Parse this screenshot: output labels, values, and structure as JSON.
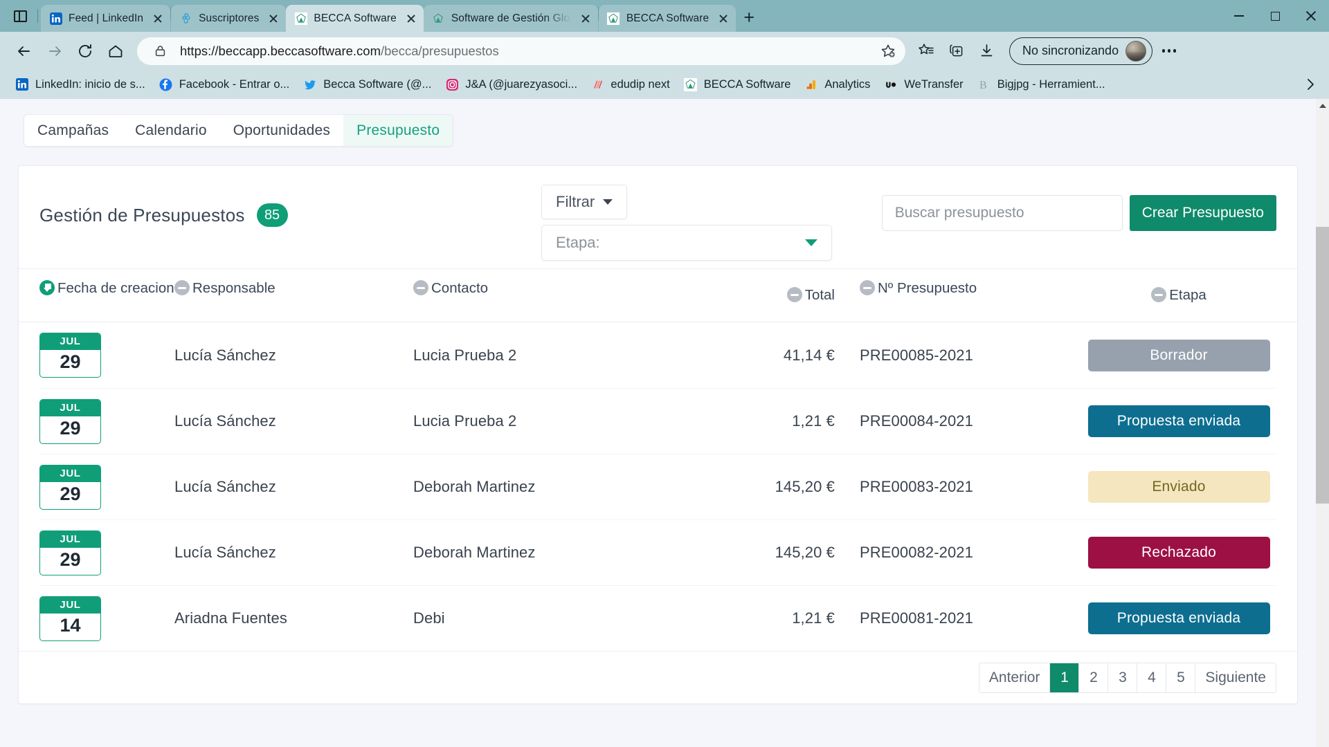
{
  "browser": {
    "tabs": [
      {
        "title": "Feed | LinkedIn",
        "icon": "linkedin-favicon",
        "active": false
      },
      {
        "title": "Suscriptores",
        "icon": "mailchimp-favicon",
        "active": false
      },
      {
        "title": "BECCA Software",
        "icon": "becca-favicon",
        "active": true
      },
      {
        "title": "Software de Gestión Glob",
        "icon": "becca-favicon",
        "active": false
      },
      {
        "title": "BECCA Software",
        "icon": "becca-favicon",
        "active": false
      }
    ],
    "newtab_label": "+",
    "window_controls": {
      "minimize": "minimize-button",
      "maximize": "maximize-button",
      "close": "close-button"
    },
    "nav": {
      "back": "back-arrow-icon",
      "forward": "forward-arrow-icon",
      "reload": "reload-icon",
      "home": "home-icon"
    },
    "address": {
      "lock": "lock-icon",
      "url_strong": "https://beccapp.beccasoftware.com",
      "url_dim": "/becca/presupuestos",
      "favorite": "add-favorite-star-icon"
    },
    "toolbar": {
      "collections": "favorites-list-icon",
      "split": "collections-icon",
      "downloads": "downloads-icon",
      "sync_label": "No sincronizando",
      "avatar": "profile-avatar",
      "settings": "more-options-icon"
    },
    "bookmarks": [
      {
        "label": "LinkedIn: inicio de s...",
        "icon": "linkedin-icon"
      },
      {
        "label": "Facebook - Entrar o...",
        "icon": "facebook-icon"
      },
      {
        "label": "Becca Software (@...",
        "icon": "twitter-icon"
      },
      {
        "label": "J&A (@juarezyasoci...",
        "icon": "instagram-icon"
      },
      {
        "label": "edudip next",
        "icon": "edudip-icon"
      },
      {
        "label": "BECCA Software",
        "icon": "becca-icon"
      },
      {
        "label": "Analytics",
        "icon": "analytics-icon"
      },
      {
        "label": "WeTransfer",
        "icon": "wetransfer-icon"
      },
      {
        "label": "Bigjpg - Herramient...",
        "icon": "bigjpg-icon"
      }
    ],
    "bookmarks_overflow": "chevron-right-icon"
  },
  "app": {
    "nav_tabs": [
      {
        "label": "Campañas",
        "active": false
      },
      {
        "label": "Calendario",
        "active": false
      },
      {
        "label": "Oportunidades",
        "active": false
      },
      {
        "label": "Presupuesto",
        "active": true
      }
    ],
    "header": {
      "title": "Gestión de Presupuestos",
      "count": "85",
      "filter_button": "Filtrar",
      "stage_select_placeholder": "Etapa:",
      "search_placeholder": "Buscar presupuesto",
      "search_value": "",
      "create_button": "Crear Presupuesto"
    },
    "table": {
      "columns": [
        {
          "label": "Fecha de creacion",
          "sort": "desc"
        },
        {
          "label": "Responsable",
          "sort": "none"
        },
        {
          "label": "Contacto",
          "sort": "none"
        },
        {
          "label": "Total",
          "sort": "none"
        },
        {
          "label": "Nº Presupuesto",
          "sort": "none"
        },
        {
          "label": "Etapa",
          "sort": "none"
        }
      ],
      "rows": [
        {
          "month": "JUL",
          "day": "29",
          "responsable": "Lucía Sánchez",
          "contacto": "Lucia Prueba 2",
          "total": "41,14 €",
          "numero": "PRE00085-2021",
          "etapa": "Borrador",
          "etapa_style": "borrador"
        },
        {
          "month": "JUL",
          "day": "29",
          "responsable": "Lucía Sánchez",
          "contacto": "Lucia Prueba 2",
          "total": "1,21 €",
          "numero": "PRE00084-2021",
          "etapa": "Propuesta enviada",
          "etapa_style": "propuesta"
        },
        {
          "month": "JUL",
          "day": "29",
          "responsable": "Lucía Sánchez",
          "contacto": "Deborah Martinez",
          "total": "145,20 €",
          "numero": "PRE00083-2021",
          "etapa": "Enviado",
          "etapa_style": "enviado"
        },
        {
          "month": "JUL",
          "day": "29",
          "responsable": "Lucía Sánchez",
          "contacto": "Deborah Martinez",
          "total": "145,20 €",
          "numero": "PRE00082-2021",
          "etapa": "Rechazado",
          "etapa_style": "rechazado"
        },
        {
          "month": "JUL",
          "day": "14",
          "responsable": "Ariadna Fuentes",
          "contacto": "Debi",
          "total": "1,21 €",
          "numero": "PRE00081-2021",
          "etapa": "Propuesta enviada",
          "etapa_style": "propuesta"
        }
      ]
    },
    "pagination": {
      "previous": "Anterior",
      "pages": [
        "1",
        "2",
        "3",
        "4",
        "5"
      ],
      "current": "1",
      "next": "Siguiente"
    }
  },
  "colors": {
    "brand_green": "#0f9e78",
    "button_green": "#0f8a6a",
    "chrome_tabstrip": "#84b4bc",
    "chrome_toolbar": "#cfe0e4",
    "status_borrador": "#97a1ae",
    "status_propuesta": "#0d6e90",
    "status_enviado": "#f5e6bf",
    "status_rechazado": "#9c1044"
  }
}
